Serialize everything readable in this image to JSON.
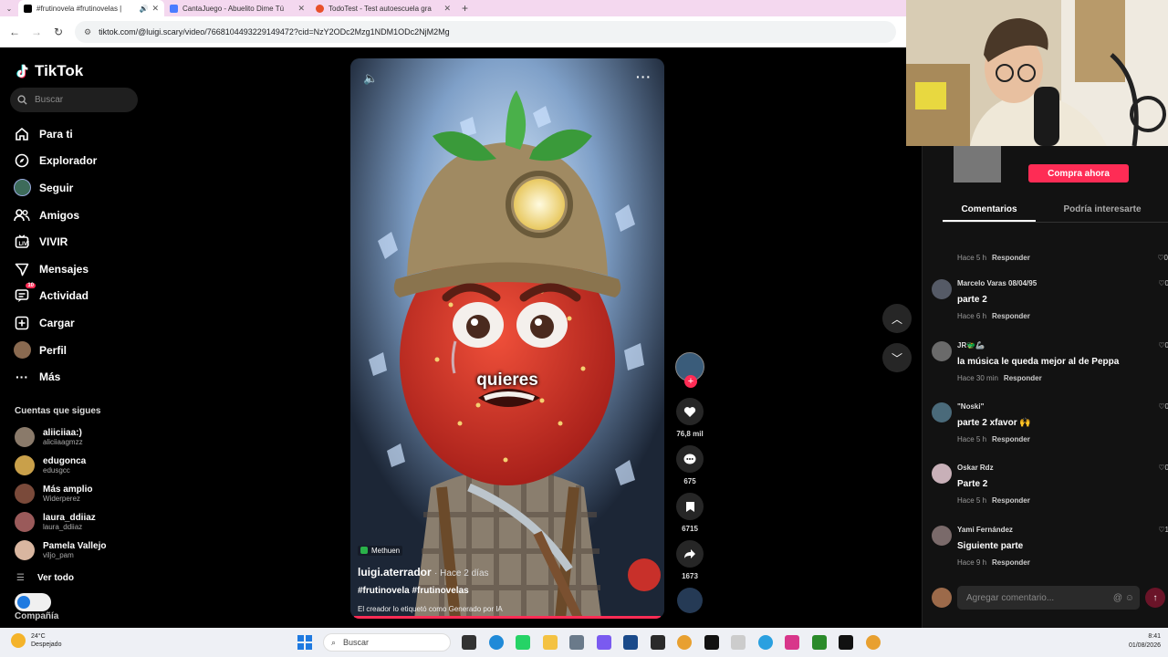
{
  "browser": {
    "tabs": [
      {
        "title": "#frutinovela #frutinovelas |",
        "active": true,
        "favicon_color": "#000000"
      },
      {
        "title": "CantaJuego - Abuelito Dime Tú",
        "active": false,
        "favicon_color": "#4a7cff"
      },
      {
        "title": "TodoTest - Test autoescuela gra",
        "active": false,
        "favicon_color": "#e8502a"
      }
    ],
    "url": "tiktok.com/@luigi.scary/video/7668104493229149472?cid=NzY2ODc2Mzg1NDM1ODc2NjM2Mg"
  },
  "sidebar": {
    "logo": "TikTok",
    "search_placeholder": "Buscar",
    "nav": [
      {
        "label": "Para ti",
        "icon": "home-icon"
      },
      {
        "label": "Explorador",
        "icon": "compass-icon"
      },
      {
        "label": "Seguir",
        "icon": "following-avatar-icon"
      },
      {
        "label": "Amigos",
        "icon": "friends-icon"
      },
      {
        "label": "VIVIR",
        "icon": "live-icon"
      },
      {
        "label": "Mensajes",
        "icon": "messages-icon"
      },
      {
        "label": "Actividad",
        "icon": "activity-icon",
        "badge": "10"
      },
      {
        "label": "Cargar",
        "icon": "upload-icon"
      },
      {
        "label": "Perfil",
        "icon": "profile-avatar-icon"
      },
      {
        "label": "Más",
        "icon": "more-dots-icon"
      }
    ],
    "following_heading": "Cuentas que sigues",
    "following": [
      {
        "name": "aliiciiaa:)",
        "handle": "aliciiaagmzz",
        "color": "#8a7a6a"
      },
      {
        "name": "edugonca",
        "handle": "edusgcc",
        "color": "#c9a04a"
      },
      {
        "name": "Más amplio",
        "handle": "Widerperez",
        "color": "#7a4a3a"
      },
      {
        "name": "laura_ddiiaz",
        "handle": "laura_ddiiaz",
        "color": "#9a5a5a"
      },
      {
        "name": "Pamela Vallejo",
        "handle": "viljo_pam",
        "color": "#d9b6a0"
      }
    ],
    "see_all": "Ver todo",
    "company": "Compañía"
  },
  "video": {
    "caption_word": "quieres",
    "location": "Methuen",
    "author": "luigi.aterrador",
    "posted": "· Hace 2 días",
    "hashtags": "#frutinovela #frutinovelas",
    "ai_label": "El creador lo etiquetó como Generado por IA",
    "likes": "76,8 mil",
    "comments": "675",
    "saves": "6715",
    "shares": "1673"
  },
  "right_panel": {
    "buy_button": "Compra ahora",
    "tabs": [
      "Comentarios",
      "Podría interesarte"
    ],
    "first_meta": {
      "time": "Hace 5 h",
      "reply": "Responder",
      "likes": "0"
    },
    "comments": [
      {
        "user": "Marcelo Varas 08/04/95",
        "text": "parte 2",
        "time": "Hace 6 h",
        "reply": "Responder",
        "likes": "0",
        "color": "#555a66"
      },
      {
        "user": "JR🐲🦾",
        "text": "la música le queda mejor al de Peppa",
        "time": "Hace 30 min",
        "reply": "Responder",
        "likes": "0",
        "color": "#6a6a6a"
      },
      {
        "user": "\"Noski\"",
        "text": "parte 2 xfavor 🙌",
        "time": "Hace 5 h",
        "reply": "Responder",
        "likes": "0",
        "color": "#4a6a7a"
      },
      {
        "user": "Oskar Rdz",
        "text": "Parte 2",
        "time": "Hace 5 h",
        "reply": "Responder",
        "likes": "0",
        "color": "#c8b0b8"
      },
      {
        "user": "Yami Fernández",
        "text": "Siguiente parte",
        "time": "Hace 9 h",
        "reply": "Responder",
        "likes": "1",
        "color": "#7a6a6a"
      }
    ],
    "add_comment_placeholder": "Agregar comentario..."
  },
  "taskbar": {
    "temp": "24°C",
    "weather": "Despejado",
    "search": "Buscar",
    "time": "8:41",
    "date": "01/08/2026"
  }
}
